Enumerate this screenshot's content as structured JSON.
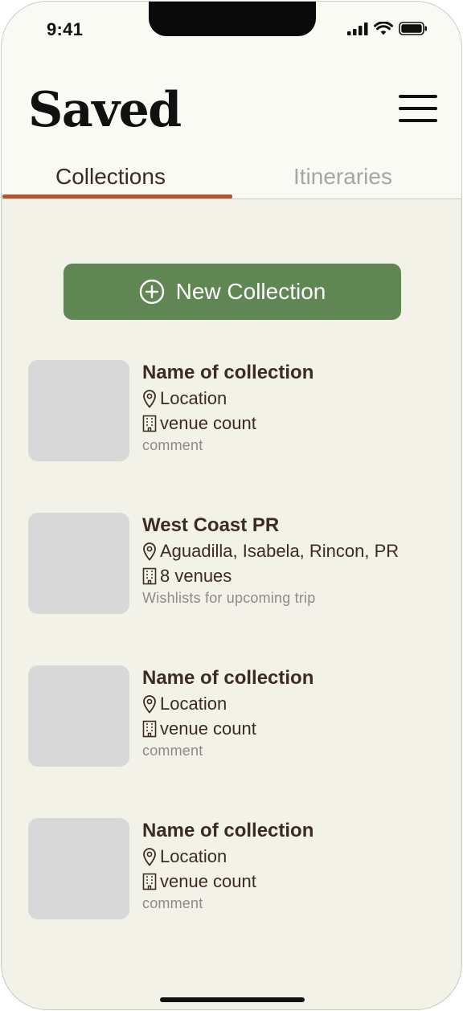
{
  "status_bar": {
    "time": "9:41"
  },
  "header": {
    "title": "Saved"
  },
  "tabs": [
    {
      "label": "Collections",
      "active": true
    },
    {
      "label": "Itineraries",
      "active": false
    }
  ],
  "new_collection": {
    "label": "New Collection"
  },
  "collections": [
    {
      "name": "Name of collection",
      "location": "Location",
      "venue_count": "venue count",
      "comment": "comment"
    },
    {
      "name": "West Coast PR",
      "location": "Aguadilla, Isabela, Rincon, PR",
      "venue_count": "8 venues",
      "comment": "Wishlists for upcoming trip"
    },
    {
      "name": "Name of collection",
      "location": "Location",
      "venue_count": "venue count",
      "comment": "comment"
    },
    {
      "name": "Name of collection",
      "location": "Location",
      "venue_count": "venue count",
      "comment": "comment"
    }
  ],
  "colors": {
    "accent": "#b1582f",
    "button": "#608653",
    "text": "#3b2b22",
    "muted": "#8e8a85",
    "background": "#f3f2e8",
    "thumbnail": "#d8d8d8"
  },
  "icons": [
    "signal-icon",
    "wifi-icon",
    "battery-icon",
    "menu-icon",
    "plus-circle-icon",
    "location-pin-icon",
    "building-icon"
  ]
}
